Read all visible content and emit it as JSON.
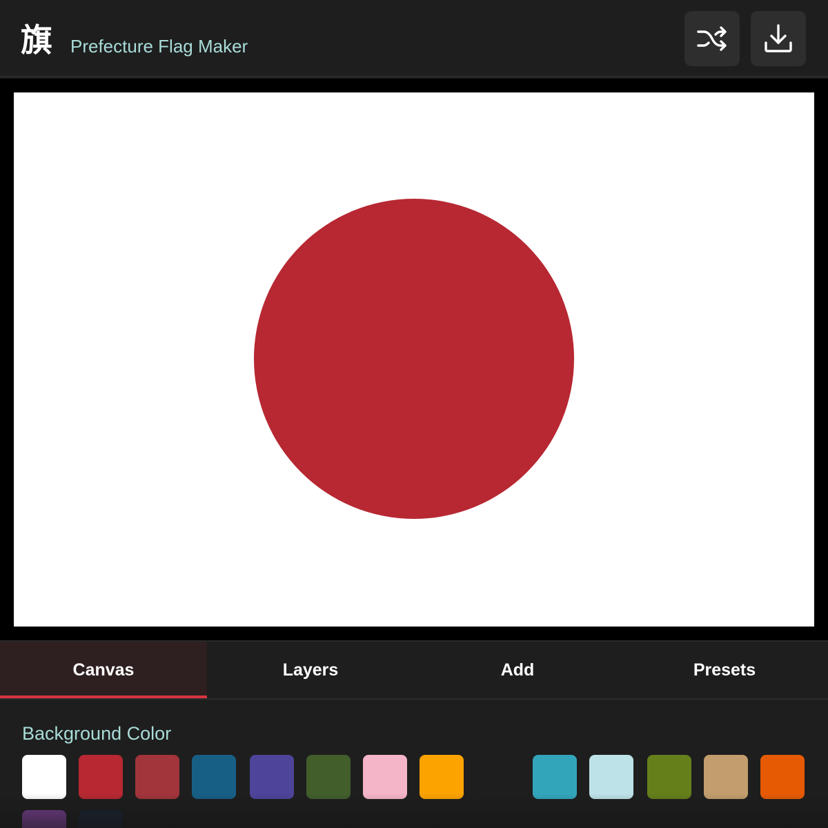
{
  "header": {
    "logo_glyph": "旗",
    "title": "Prefecture Flag Maker",
    "shuffle_icon": "shuffle-icon",
    "download_icon": "download-icon"
  },
  "flag": {
    "background": "#ffffff",
    "disc_color": "#b72832"
  },
  "tabs": [
    {
      "label": "Canvas",
      "active": true
    },
    {
      "label": "Layers",
      "active": false
    },
    {
      "label": "Add",
      "active": false
    },
    {
      "label": "Presets",
      "active": false
    }
  ],
  "panel": {
    "section_label": "Background Color",
    "swatches": [
      {
        "color": "#ffffff",
        "selected": true
      },
      {
        "color": "#b72832"
      },
      {
        "color": "#a2343b"
      },
      {
        "color": "#185f86"
      },
      {
        "color": "#4e4499"
      },
      {
        "color": "#415e2b"
      },
      {
        "color": "#f5b5c8"
      },
      {
        "color": "#fca300"
      },
      {
        "color": "#1e1e1e"
      },
      {
        "color": "#33a5bb"
      },
      {
        "color": "#bde2e8"
      },
      {
        "color": "#657f1b"
      },
      {
        "color": "#c39d6d"
      },
      {
        "color": "#e65a04"
      },
      {
        "color": "#763f8e"
      },
      {
        "color": "#1a2230"
      }
    ]
  },
  "colors": {
    "accent": "#d7353f",
    "title": "#a9dcd8"
  }
}
